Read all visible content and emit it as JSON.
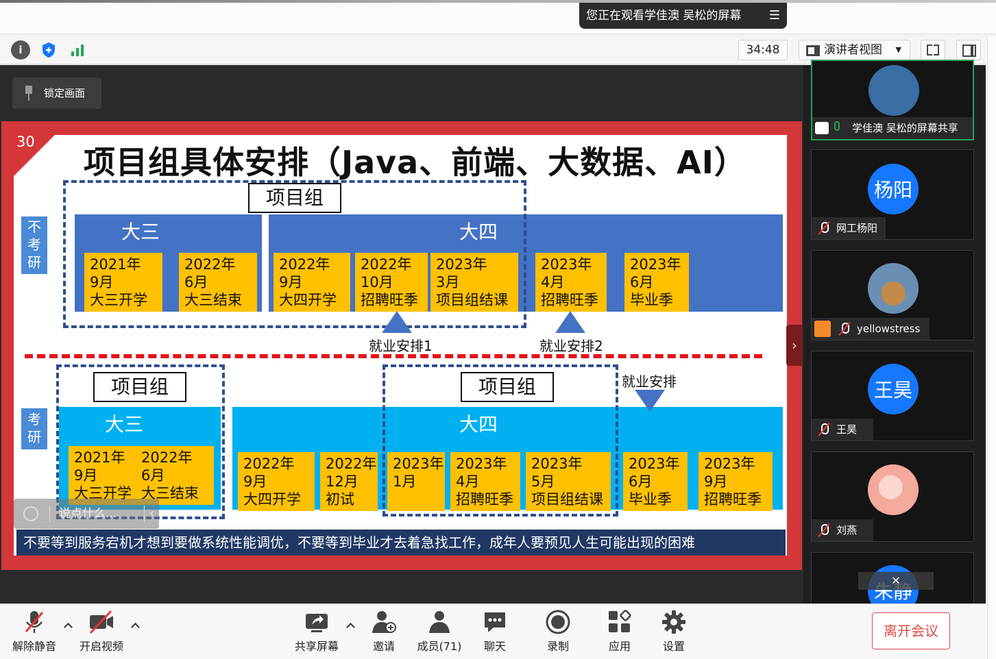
{
  "banner": {
    "watching": "您正在观看学佳澳 吴松的屏幕"
  },
  "toolbar": {
    "timer": "34:48",
    "view_label": "演讲者视图"
  },
  "lock": {
    "label": "锁定画面"
  },
  "slide": {
    "number": "30",
    "title": "项目组具体安排（Java、前端、大数据、AI）",
    "top": {
      "side_label": "不\n考\n研",
      "group_box": "项目组",
      "band_left_label": "大三",
      "band_right_label": "大四",
      "boxes": [
        "2021年\n9月\n大三开学",
        "2022年\n6月\n大三结束",
        "2022年\n9月\n大四开学",
        "2022年\n10月\n招聘旺季",
        "2023年\n3月\n项目组结课",
        "2023年\n4月\n招聘旺季",
        "2023年\n6月\n毕业季"
      ],
      "anno1": "就业安排1",
      "anno2": "就业安排2"
    },
    "bottom": {
      "side_label": "考\n研",
      "group_box_left": "项目组",
      "group_box_right": "项目组",
      "band_left_label": "大三",
      "band_right_label": "大四",
      "anno": "就业安排",
      "left_boxes": [
        "2021年\n9月\n大三开学",
        "2022年\n6月\n大三结束"
      ],
      "boxes": [
        "2022年\n9月\n大四开学",
        "2022年\n12月\n初试",
        "2023年\n1月",
        "2023年\n4月\n招聘旺季",
        "2023年\n5月\n项目组结课",
        "2023年\n6月\n毕业季",
        "2023年\n9月\n招聘旺季"
      ]
    },
    "footer": "不要等到服务宕机才想到要做系统性能调优，不要等到毕业才去着急找工作，成年人要预见人生可能出现的困难"
  },
  "chat_overlay": {
    "placeholder": "说点什么..."
  },
  "participants": [
    {
      "name": "学佳澳 吴松的屏幕共享",
      "avatar": "",
      "color": "#3a6ea5"
    },
    {
      "name": "网工杨阳",
      "avatar": "杨阳",
      "color": "#1677ff"
    },
    {
      "name": "yellowstress",
      "avatar": "",
      "color": "#6b8fb3"
    },
    {
      "name": "王昊",
      "avatar": "王昊",
      "color": "#1677ff"
    },
    {
      "name": "刘燕",
      "avatar": "",
      "color": "#f3a99c"
    },
    {
      "name": "",
      "avatar": "朱静",
      "color": "#1677ff"
    }
  ],
  "bottom_bar": {
    "unmute": "解除静音",
    "video": "开启视频",
    "share": "共享屏幕",
    "invite": "邀请",
    "members": "成员(71)",
    "chat": "聊天",
    "record": "录制",
    "apps": "应用",
    "settings": "设置",
    "leave": "离开会议"
  }
}
